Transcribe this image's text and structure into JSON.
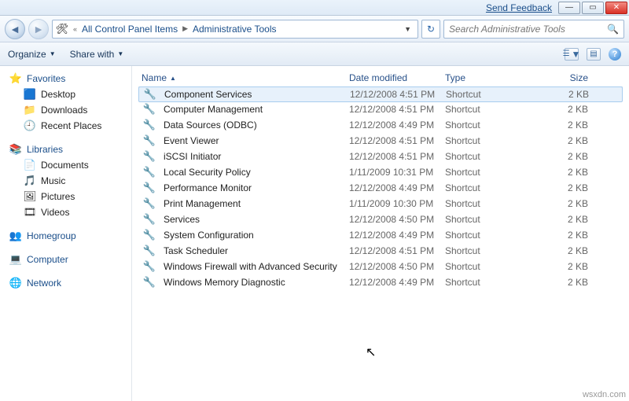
{
  "titlebar": {
    "feedback": "Send Feedback"
  },
  "nav": {
    "crumb1": "All Control Panel Items",
    "crumb2": "Administrative Tools",
    "search_placeholder": "Search Administrative Tools"
  },
  "toolbar": {
    "organize": "Organize",
    "share": "Share with"
  },
  "sidebar": {
    "favorites": {
      "label": "Favorites",
      "items": [
        {
          "label": "Desktop",
          "icon": "🟦"
        },
        {
          "label": "Downloads",
          "icon": "📁"
        },
        {
          "label": "Recent Places",
          "icon": "🕘"
        }
      ]
    },
    "libraries": {
      "label": "Libraries",
      "items": [
        {
          "label": "Documents",
          "icon": "📄"
        },
        {
          "label": "Music",
          "icon": "🎵"
        },
        {
          "label": "Pictures",
          "icon": "🖼"
        },
        {
          "label": "Videos",
          "icon": "🎞"
        }
      ]
    },
    "homegroup": {
      "label": "Homegroup",
      "icon": "👥"
    },
    "computer": {
      "label": "Computer",
      "icon": "💻"
    },
    "network": {
      "label": "Network",
      "icon": "🌐"
    }
  },
  "columns": {
    "name": "Name",
    "date": "Date modified",
    "type": "Type",
    "size": "Size"
  },
  "files": [
    {
      "name": "Component Services",
      "date": "12/12/2008 4:51 PM",
      "type": "Shortcut",
      "size": "2 KB",
      "selected": true
    },
    {
      "name": "Computer Management",
      "date": "12/12/2008 4:51 PM",
      "type": "Shortcut",
      "size": "2 KB"
    },
    {
      "name": "Data Sources (ODBC)",
      "date": "12/12/2008 4:49 PM",
      "type": "Shortcut",
      "size": "2 KB"
    },
    {
      "name": "Event Viewer",
      "date": "12/12/2008 4:51 PM",
      "type": "Shortcut",
      "size": "2 KB"
    },
    {
      "name": "iSCSI Initiator",
      "date": "12/12/2008 4:51 PM",
      "type": "Shortcut",
      "size": "2 KB"
    },
    {
      "name": "Local Security Policy",
      "date": "1/11/2009 10:31 PM",
      "type": "Shortcut",
      "size": "2 KB"
    },
    {
      "name": "Performance Monitor",
      "date": "12/12/2008 4:49 PM",
      "type": "Shortcut",
      "size": "2 KB"
    },
    {
      "name": "Print Management",
      "date": "1/11/2009 10:30 PM",
      "type": "Shortcut",
      "size": "2 KB"
    },
    {
      "name": "Services",
      "date": "12/12/2008 4:50 PM",
      "type": "Shortcut",
      "size": "2 KB"
    },
    {
      "name": "System Configuration",
      "date": "12/12/2008 4:49 PM",
      "type": "Shortcut",
      "size": "2 KB"
    },
    {
      "name": "Task Scheduler",
      "date": "12/12/2008 4:51 PM",
      "type": "Shortcut",
      "size": "2 KB"
    },
    {
      "name": "Windows Firewall with Advanced Security",
      "date": "12/12/2008 4:50 PM",
      "type": "Shortcut",
      "size": "2 KB"
    },
    {
      "name": "Windows Memory Diagnostic",
      "date": "12/12/2008 4:49 PM",
      "type": "Shortcut",
      "size": "2 KB"
    }
  ],
  "watermark": "wsxdn.com"
}
